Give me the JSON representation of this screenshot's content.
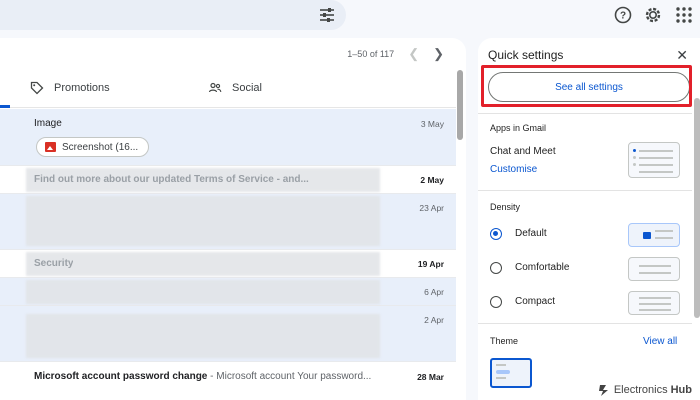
{
  "pager": {
    "range": "1–50 of 117"
  },
  "tabs": [
    {
      "label": "Promotions",
      "icon": "tag-icon"
    },
    {
      "label": "Social",
      "icon": "people-icon"
    }
  ],
  "emails": [
    {
      "subject": "Image",
      "date": "3 May",
      "chip": "Screenshot (16...",
      "unread": false
    },
    {
      "subject": "Find out more about our updated Terms of Service - and...",
      "date": "2 May",
      "unread": true
    },
    {
      "subject": "",
      "date": "23 Apr",
      "unread": false
    },
    {
      "subject": "Security",
      "date": "19 Apr",
      "unread": true
    },
    {
      "subject": "",
      "date": "6 Apr",
      "unread": false
    },
    {
      "subject": "",
      "date": "2 Apr",
      "unread": false
    },
    {
      "subject": "Microsoft account password change",
      "snippet": " - Microsoft account Your password...",
      "date": "28 Mar",
      "unread": true
    }
  ],
  "quick_settings": {
    "title": "Quick settings",
    "see_all": "See all settings",
    "apps_label": "Apps in Gmail",
    "chat_meet": "Chat and Meet",
    "customise": "Customise",
    "density_label": "Density",
    "density_options": [
      {
        "label": "Default",
        "selected": true
      },
      {
        "label": "Comfortable",
        "selected": false
      },
      {
        "label": "Compact",
        "selected": false
      }
    ],
    "theme_label": "Theme",
    "view_all": "View all"
  },
  "watermark": {
    "brand": "Electronics",
    "hub": "Hub"
  },
  "colors": {
    "accent": "#0b57d0",
    "highlight": "#e2202a",
    "background": "#f6f8fc"
  }
}
